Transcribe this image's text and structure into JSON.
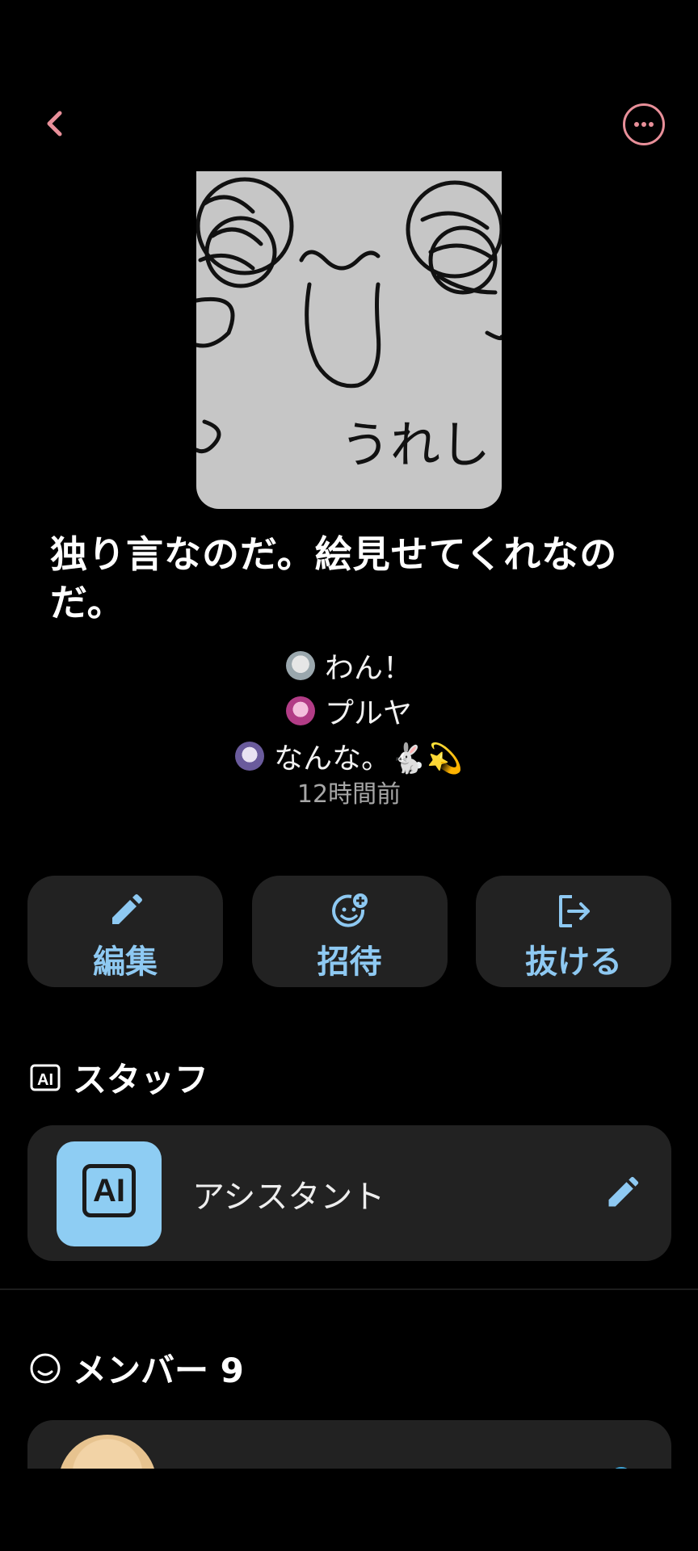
{
  "header": {
    "back_icon": "chevron-left-icon",
    "more_icon": "more-horizontal-icon",
    "accent": "#e88f99"
  },
  "chat": {
    "title": "独り言なのだ。絵見せてくれなのだ。",
    "cover_text": "うれし",
    "members_preview": [
      {
        "name": "わん！"
      },
      {
        "name": "プルヤ"
      },
      {
        "name": "なんな。🐇💫"
      }
    ],
    "timestamp": "12時間前"
  },
  "actions": [
    {
      "label": "編集",
      "icon": "pencil-icon"
    },
    {
      "label": "招待",
      "icon": "add-person-icon"
    },
    {
      "label": "抜ける",
      "icon": "logout-icon"
    }
  ],
  "staff": {
    "heading": "スタッフ",
    "badge": "AI",
    "item": {
      "name": "アシスタント",
      "avatar_text": "AI",
      "avatar_color": "#8ecdf3"
    }
  },
  "members": {
    "heading": "メンバー 9"
  },
  "colors": {
    "link_blue": "#8ec9f2",
    "card": "#222222"
  }
}
